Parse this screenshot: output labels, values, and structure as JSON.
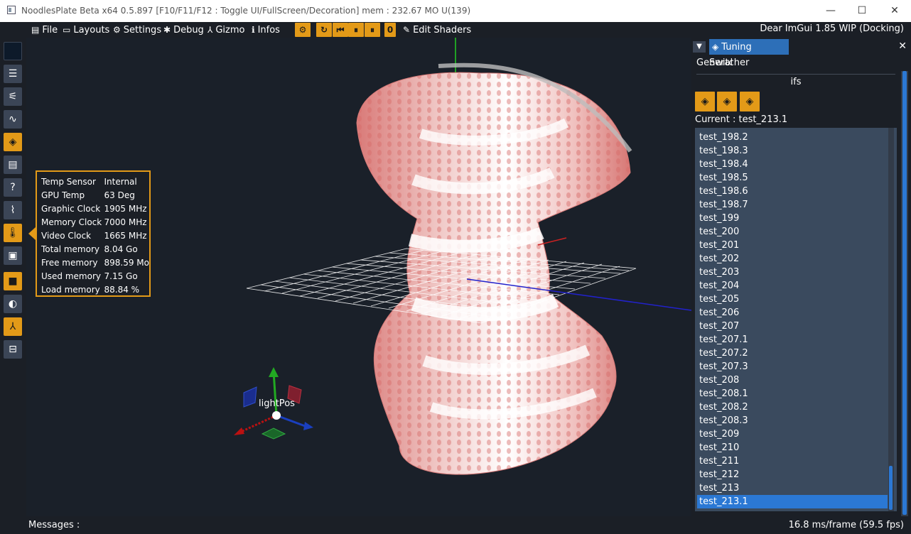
{
  "titlebar": {
    "title": "NoodlesPlate Beta x64 0.5.897 [F10/F11/F12 : Toggle UI/FullScreen/Decoration] mem : 232.67 MO U(139)",
    "minimize": "—",
    "maximize": "☐",
    "close": "✕"
  },
  "menu": {
    "file": "File",
    "layouts": "Layouts",
    "settings": "Settings",
    "debug": "Debug",
    "gizmo": "Gizmo",
    "infos": "Infos",
    "frame_counter": "0",
    "edit_shaders": "Edit Shaders",
    "version": "Dear ImGui 1.85 WIP (Docking)"
  },
  "left_toolbar": {
    "icons": [
      "dark-square-icon",
      "list-icon",
      "sliders-icon",
      "curve-icon",
      "layers-icon",
      "document-icon",
      "help-icon",
      "pulse-icon",
      "thermometer-icon",
      "comments-icon",
      "camera-icon",
      "mouse-icon",
      "gizmo-icon",
      "gamepad-icon"
    ]
  },
  "gpu_info": [
    {
      "key": "Temp Sensor",
      "value": "Internal"
    },
    {
      "key": "GPU Temp",
      "value": "63 Deg"
    },
    {
      "key": "Graphic Clock",
      "value": "1905 MHz"
    },
    {
      "key": "Memory Clock",
      "value": "7000 MHz"
    },
    {
      "key": "Video Clock",
      "value": "1665 MHz"
    },
    {
      "key": "Total memory",
      "value": "8.04 Go"
    },
    {
      "key": "Free memory",
      "value": "898.59 Mo"
    },
    {
      "key": "Used memory",
      "value": "7.15 Go"
    },
    {
      "key": "Load memory",
      "value": "88.84 %"
    }
  ],
  "viewport": {
    "gizmo_label": "lightPos"
  },
  "tuning": {
    "tab": "Tuning Switcher",
    "section": "General",
    "group": "ifs",
    "current": "Current : test_213.1",
    "items": [
      "test_198.2",
      "test_198.3",
      "test_198.4",
      "test_198.5",
      "test_198.6",
      "test_198.7",
      "test_199",
      "test_200",
      "test_201",
      "test_202",
      "test_203",
      "test_204",
      "test_205",
      "test_206",
      "test_207",
      "test_207.1",
      "test_207.2",
      "test_207.3",
      "test_208",
      "test_208.1",
      "test_208.2",
      "test_208.3",
      "test_209",
      "test_210",
      "test_211",
      "test_212",
      "test_213",
      "test_213.1"
    ],
    "selected": "test_213.1"
  },
  "status": {
    "messages": "Messages :",
    "fps": "16.8 ms/frame (59.5 fps)"
  },
  "colors": {
    "accent": "#e39a18",
    "selection": "#2b78d4",
    "background": "#1a2029",
    "panel": "#1b1f26"
  }
}
